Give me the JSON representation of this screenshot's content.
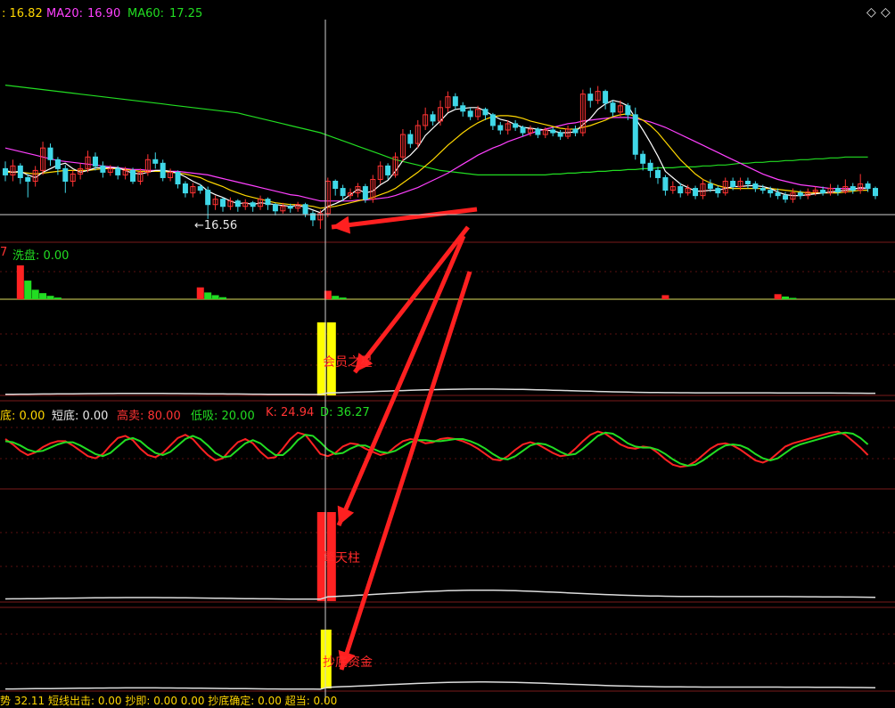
{
  "ma_legend": {
    "ma5_value": ": 16.82",
    "ma20_label": "MA20:",
    "ma20_value": "16.90",
    "ma60_label": "MA60:",
    "ma60_value": "17.25"
  },
  "panel_washout": {
    "num": "7",
    "label": "洗盘: 0.00"
  },
  "panel_kdj": {
    "bottom": "底: 0.00",
    "short_bottom": "短底: 0.00",
    "high_sell": "高卖: 80.00",
    "low_buy": "低吸: 20.00",
    "k": "K: 24.94",
    "d": "D: 36.27"
  },
  "bottom_row": "势  32.11    短线出击: 0.00   抄即: 0.00  0.00   抄底确定: 0.00   超当: 0.00",
  "annotations": {
    "low_price": "16.56",
    "star": "会员之星",
    "pillar": "擎天柱",
    "gold": "抄底资金"
  },
  "colors": {
    "up": "#ff3333",
    "down": "#40d8e8",
    "ma5": "#ffffff",
    "ma10": "#ffd700",
    "ma20": "#ff40ff",
    "ma60": "#22dd22",
    "arrow": "#ff2020"
  },
  "chart_data": {
    "type": "candlestick",
    "title": "",
    "price_range": [
      16.4,
      18.7
    ],
    "candles": [
      [
        17.12,
        17.05,
        17.2,
        16.98
      ],
      [
        17.05,
        17.15,
        17.22,
        16.98
      ],
      [
        17.15,
        17.02,
        17.18,
        16.95
      ],
      [
        17.02,
        16.98,
        17.06,
        16.8
      ],
      [
        16.98,
        17.1,
        17.15,
        16.92
      ],
      [
        17.1,
        17.35,
        17.42,
        17.05
      ],
      [
        17.35,
        17.22,
        17.4,
        17.15
      ],
      [
        17.22,
        17.12,
        17.25,
        17.05
      ],
      [
        17.12,
        16.98,
        17.16,
        16.85
      ],
      [
        16.98,
        17.06,
        17.1,
        16.92
      ],
      [
        17.06,
        17.12,
        17.18,
        17.0
      ],
      [
        17.12,
        17.25,
        17.32,
        17.08
      ],
      [
        17.25,
        17.15,
        17.3,
        17.1
      ],
      [
        17.15,
        17.08,
        17.2,
        17.02
      ],
      [
        17.08,
        17.12,
        17.16,
        17.04
      ],
      [
        17.12,
        17.05,
        17.15,
        17.0
      ],
      [
        17.05,
        17.1,
        17.14,
        17.0
      ],
      [
        17.1,
        16.98,
        17.13,
        16.95
      ],
      [
        16.98,
        17.08,
        17.12,
        16.94
      ],
      [
        17.08,
        17.22,
        17.28,
        17.04
      ],
      [
        17.22,
        17.18,
        17.3,
        17.12
      ],
      [
        17.18,
        17.02,
        17.22,
        16.98
      ],
      [
        17.02,
        17.08,
        17.12,
        16.98
      ],
      [
        17.08,
        16.95,
        17.1,
        16.9
      ],
      [
        16.95,
        16.85,
        16.98,
        16.8
      ],
      [
        16.85,
        16.92,
        16.96,
        16.8
      ],
      [
        16.92,
        16.88,
        16.95,
        16.84
      ],
      [
        16.88,
        16.72,
        16.92,
        16.56
      ],
      [
        16.72,
        16.78,
        16.82,
        16.66
      ],
      [
        16.78,
        16.7,
        16.8,
        16.64
      ],
      [
        16.7,
        16.76,
        16.8,
        16.66
      ],
      [
        16.76,
        16.7,
        16.78,
        16.64
      ],
      [
        16.7,
        16.74,
        16.78,
        16.66
      ],
      [
        16.74,
        16.7,
        16.76,
        16.64
      ],
      [
        16.7,
        16.78,
        16.82,
        16.66
      ],
      [
        16.78,
        16.72,
        16.8,
        16.66
      ],
      [
        16.72,
        16.65,
        16.74,
        16.6
      ],
      [
        16.65,
        16.7,
        16.74,
        16.62
      ],
      [
        16.7,
        16.68,
        16.73,
        16.63
      ],
      [
        16.68,
        16.72,
        16.75,
        16.64
      ],
      [
        16.72,
        16.62,
        16.74,
        16.58
      ],
      [
        16.62,
        16.55,
        16.65,
        16.48
      ],
      [
        16.55,
        16.62,
        16.66,
        16.45
      ],
      [
        16.62,
        16.98,
        17.02,
        16.58
      ],
      [
        16.98,
        16.9,
        17.0,
        16.82
      ],
      [
        16.9,
        16.82,
        16.94,
        16.76
      ],
      [
        16.82,
        16.85,
        16.9,
        16.78
      ],
      [
        16.85,
        16.92,
        16.96,
        16.8
      ],
      [
        16.92,
        16.78,
        16.95,
        16.74
      ],
      [
        16.78,
        17.0,
        17.05,
        16.74
      ],
      [
        17.0,
        17.15,
        17.2,
        16.95
      ],
      [
        17.15,
        17.05,
        17.18,
        17.0
      ],
      [
        17.05,
        17.25,
        17.3,
        17.02
      ],
      [
        17.25,
        17.5,
        17.56,
        17.2
      ],
      [
        17.5,
        17.4,
        17.55,
        17.35
      ],
      [
        17.4,
        17.6,
        17.66,
        17.35
      ],
      [
        17.6,
        17.72,
        17.8,
        17.55
      ],
      [
        17.72,
        17.65,
        17.76,
        17.6
      ],
      [
        17.65,
        17.8,
        17.88,
        17.6
      ],
      [
        17.8,
        17.92,
        17.98,
        17.75
      ],
      [
        17.92,
        17.82,
        17.96,
        17.78
      ],
      [
        17.82,
        17.76,
        17.86,
        17.7
      ],
      [
        17.76,
        17.7,
        17.8,
        17.66
      ],
      [
        17.7,
        17.78,
        17.82,
        17.66
      ],
      [
        17.78,
        17.72,
        17.8,
        17.66
      ],
      [
        17.72,
        17.6,
        17.74,
        17.55
      ],
      [
        17.6,
        17.55,
        17.64,
        17.5
      ],
      [
        17.55,
        17.62,
        17.66,
        17.5
      ],
      [
        17.62,
        17.58,
        17.66,
        17.54
      ],
      [
        17.58,
        17.52,
        17.6,
        17.48
      ],
      [
        17.52,
        17.56,
        17.6,
        17.48
      ],
      [
        17.56,
        17.5,
        17.58,
        17.46
      ],
      [
        17.5,
        17.55,
        17.58,
        17.46
      ],
      [
        17.55,
        17.52,
        17.58,
        17.48
      ],
      [
        17.52,
        17.48,
        17.55,
        17.44
      ],
      [
        17.48,
        17.56,
        17.6,
        17.45
      ],
      [
        17.56,
        17.52,
        17.6,
        17.48
      ],
      [
        17.52,
        17.95,
        18.0,
        17.48
      ],
      [
        17.95,
        17.88,
        18.02,
        17.8
      ],
      [
        17.88,
        17.98,
        18.04,
        17.84
      ],
      [
        17.98,
        17.85,
        18.0,
        17.78
      ],
      [
        17.85,
        17.75,
        17.88,
        17.7
      ],
      [
        17.75,
        17.82,
        17.88,
        17.7
      ],
      [
        17.82,
        17.72,
        17.85,
        17.66
      ],
      [
        17.72,
        17.28,
        17.8,
        17.22
      ],
      [
        17.28,
        17.18,
        17.32,
        17.1
      ],
      [
        17.18,
        17.1,
        17.22,
        17.02
      ],
      [
        17.1,
        17.02,
        17.14,
        16.95
      ],
      [
        17.02,
        16.88,
        17.05,
        16.82
      ],
      [
        16.88,
        16.92,
        16.98,
        16.84
      ],
      [
        16.92,
        16.85,
        16.96,
        16.8
      ],
      [
        16.85,
        16.9,
        16.94,
        16.82
      ],
      [
        16.9,
        16.82,
        16.93,
        16.78
      ],
      [
        16.82,
        16.95,
        17.0,
        16.78
      ],
      [
        16.95,
        16.9,
        17.0,
        16.86
      ],
      [
        16.9,
        16.85,
        16.93,
        16.8
      ],
      [
        16.85,
        16.98,
        17.02,
        16.82
      ],
      [
        16.98,
        16.92,
        17.02,
        16.88
      ],
      [
        16.92,
        16.98,
        17.02,
        16.88
      ],
      [
        16.98,
        16.95,
        17.02,
        16.9
      ],
      [
        16.95,
        16.9,
        16.98,
        16.86
      ],
      [
        16.9,
        16.88,
        16.94,
        16.84
      ],
      [
        16.88,
        16.85,
        16.92,
        16.8
      ],
      [
        16.85,
        16.82,
        16.9,
        16.78
      ],
      [
        16.82,
        16.78,
        16.86,
        16.74
      ],
      [
        16.78,
        16.85,
        16.9,
        16.74
      ],
      [
        16.85,
        16.82,
        16.88,
        16.78
      ],
      [
        16.82,
        16.86,
        16.9,
        16.78
      ],
      [
        16.86,
        16.88,
        16.92,
        16.82
      ],
      [
        16.88,
        16.85,
        16.92,
        16.82
      ],
      [
        16.85,
        16.9,
        16.95,
        16.82
      ],
      [
        16.9,
        16.86,
        16.94,
        16.82
      ],
      [
        16.86,
        16.92,
        17.0,
        16.84
      ],
      [
        16.92,
        16.88,
        16.96,
        16.84
      ],
      [
        16.88,
        16.95,
        17.06,
        16.84
      ],
      [
        16.95,
        16.9,
        16.98,
        16.86
      ],
      [
        16.9,
        16.82,
        16.92,
        16.78
      ]
    ],
    "ma5": [
      17.1,
      17.08,
      17.09,
      17.05,
      17.02,
      17.08,
      17.12,
      17.16,
      17.18,
      17.12,
      17.08,
      17.1,
      17.13,
      17.13,
      17.13,
      17.13,
      17.1,
      17.07,
      17.06,
      17.08,
      17.1,
      17.1,
      17.09,
      17.07,
      17.03,
      16.98,
      16.94,
      16.87,
      16.83,
      16.8,
      16.76,
      16.73,
      16.74,
      16.72,
      16.74,
      16.73,
      16.72,
      16.71,
      16.7,
      16.71,
      16.69,
      16.66,
      16.63,
      16.7,
      16.73,
      16.77,
      16.83,
      16.89,
      16.85,
      16.87,
      16.94,
      16.99,
      17.09,
      17.21,
      17.27,
      17.36,
      17.49,
      17.57,
      17.65,
      17.74,
      17.78,
      17.79,
      17.8,
      17.8,
      17.76,
      17.71,
      17.67,
      17.65,
      17.61,
      17.58,
      17.57,
      17.56,
      17.55,
      17.54,
      17.52,
      17.52,
      17.53,
      17.61,
      17.68,
      17.78,
      17.84,
      17.88,
      17.86,
      17.82,
      17.68,
      17.55,
      17.41,
      17.26,
      17.09,
      17.02,
      16.95,
      16.91,
      16.87,
      16.87,
      16.88,
      16.88,
      16.9,
      16.92,
      16.92,
      16.93,
      16.93,
      16.92,
      16.9,
      16.86,
      16.83,
      16.82,
      16.82,
      16.83,
      16.84,
      16.85,
      16.86,
      16.87,
      16.88,
      16.89,
      16.91,
      16.9
    ],
    "ma10": [
      17.08,
      17.08,
      17.08,
      17.07,
      17.06,
      17.07,
      17.08,
      17.09,
      17.1,
      17.1,
      17.1,
      17.1,
      17.11,
      17.12,
      17.12,
      17.12,
      17.11,
      17.1,
      17.09,
      17.09,
      17.09,
      17.09,
      17.08,
      17.07,
      17.06,
      17.04,
      17.02,
      16.98,
      16.95,
      16.92,
      16.88,
      16.85,
      16.82,
      16.8,
      16.78,
      16.76,
      16.74,
      16.73,
      16.72,
      16.72,
      16.71,
      16.7,
      16.68,
      16.69,
      16.7,
      16.72,
      16.74,
      16.76,
      16.78,
      16.8,
      16.83,
      16.86,
      16.9,
      16.96,
      17.02,
      17.08,
      17.15,
      17.22,
      17.3,
      17.38,
      17.45,
      17.52,
      17.58,
      17.63,
      17.67,
      17.7,
      17.71,
      17.71,
      17.7,
      17.68,
      17.65,
      17.63,
      17.61,
      17.59,
      17.57,
      17.56,
      17.56,
      17.58,
      17.6,
      17.63,
      17.66,
      17.7,
      17.72,
      17.73,
      17.7,
      17.66,
      17.6,
      17.52,
      17.42,
      17.32,
      17.22,
      17.14,
      17.06,
      17.0,
      16.96,
      16.93,
      16.91,
      16.9,
      16.9,
      16.9,
      16.9,
      16.9,
      16.9,
      16.89,
      16.88,
      16.87,
      16.86,
      16.85,
      16.85,
      16.85,
      16.85,
      16.85,
      16.86,
      16.87,
      16.88,
      16.88
    ],
    "ma20": [
      17.35,
      17.33,
      17.31,
      17.29,
      17.27,
      17.25,
      17.23,
      17.21,
      17.2,
      17.19,
      17.18,
      17.17,
      17.16,
      17.15,
      17.14,
      17.13,
      17.12,
      17.11,
      17.11,
      17.1,
      17.1,
      17.1,
      17.09,
      17.09,
      17.08,
      17.07,
      17.06,
      17.05,
      17.03,
      17.01,
      16.99,
      16.97,
      16.95,
      16.93,
      16.91,
      16.89,
      16.87,
      16.85,
      16.83,
      16.82,
      16.8,
      16.78,
      16.76,
      16.76,
      16.76,
      16.76,
      16.76,
      16.77,
      16.77,
      16.78,
      16.79,
      16.8,
      16.82,
      16.85,
      16.88,
      16.91,
      16.95,
      16.99,
      17.03,
      17.07,
      17.12,
      17.17,
      17.22,
      17.27,
      17.31,
      17.35,
      17.38,
      17.42,
      17.45,
      17.48,
      17.51,
      17.54,
      17.56,
      17.58,
      17.6,
      17.62,
      17.63,
      17.65,
      17.66,
      17.67,
      17.68,
      17.69,
      17.69,
      17.69,
      17.68,
      17.66,
      17.64,
      17.61,
      17.58,
      17.54,
      17.5,
      17.46,
      17.42,
      17.38,
      17.34,
      17.3,
      17.26,
      17.22,
      17.18,
      17.14,
      17.1,
      17.06,
      17.03,
      17.0,
      16.98,
      16.96,
      16.94,
      16.93,
      16.92,
      16.91,
      16.9,
      16.9,
      16.9,
      16.9,
      16.9,
      16.9
    ],
    "ma60": [
      18.05,
      18.04,
      18.03,
      18.02,
      18.01,
      18.0,
      17.99,
      17.98,
      17.97,
      17.96,
      17.95,
      17.94,
      17.93,
      17.92,
      17.91,
      17.9,
      17.89,
      17.88,
      17.87,
      17.86,
      17.85,
      17.84,
      17.83,
      17.82,
      17.81,
      17.8,
      17.79,
      17.78,
      17.77,
      17.76,
      17.75,
      17.74,
      17.72,
      17.7,
      17.68,
      17.66,
      17.64,
      17.62,
      17.6,
      17.58,
      17.56,
      17.54,
      17.52,
      17.49,
      17.46,
      17.43,
      17.4,
      17.37,
      17.34,
      17.31,
      17.28,
      17.25,
      17.22,
      17.2,
      17.18,
      17.16,
      17.14,
      17.12,
      17.1,
      17.09,
      17.08,
      17.07,
      17.06,
      17.05,
      17.05,
      17.05,
      17.05,
      17.05,
      17.05,
      17.05,
      17.05,
      17.05,
      17.05,
      17.06,
      17.06,
      17.07,
      17.07,
      17.08,
      17.08,
      17.09,
      17.09,
      17.1,
      17.1,
      17.11,
      17.11,
      17.12,
      17.12,
      17.13,
      17.13,
      17.13,
      17.14,
      17.14,
      17.14,
      17.15,
      17.15,
      17.16,
      17.16,
      17.17,
      17.18,
      17.18,
      17.19,
      17.19,
      17.2,
      17.2,
      17.21,
      17.21,
      17.22,
      17.22,
      17.23,
      17.23,
      17.24,
      17.24,
      17.25,
      17.25,
      17.25,
      17.25
    ],
    "washout": [
      {
        "i": 2,
        "h": 1.0,
        "c": "r"
      },
      {
        "i": 3,
        "h": 0.55,
        "c": "g"
      },
      {
        "i": 4,
        "h": 0.28,
        "c": "g"
      },
      {
        "i": 5,
        "h": 0.18,
        "c": "g"
      },
      {
        "i": 6,
        "h": 0.1,
        "c": "g"
      },
      {
        "i": 7,
        "h": 0.05,
        "c": "g"
      },
      {
        "i": 26,
        "h": 0.35,
        "c": "r"
      },
      {
        "i": 27,
        "h": 0.2,
        "c": "g"
      },
      {
        "i": 28,
        "h": 0.12,
        "c": "g"
      },
      {
        "i": 29,
        "h": 0.06,
        "c": "g"
      },
      {
        "i": 43,
        "h": 0.25,
        "c": "r"
      },
      {
        "i": 44,
        "h": 0.1,
        "c": "g"
      },
      {
        "i": 45,
        "h": 0.05,
        "c": "g"
      },
      {
        "i": 88,
        "h": 0.12,
        "c": "r"
      },
      {
        "i": 103,
        "h": 0.15,
        "c": "r"
      },
      {
        "i": 104,
        "h": 0.08,
        "c": "g"
      },
      {
        "i": 105,
        "h": 0.04,
        "c": "g"
      }
    ],
    "stoch_k": [
      70,
      60,
      48,
      40,
      45,
      55,
      62,
      66,
      66,
      58,
      48,
      38,
      34,
      42,
      58,
      72,
      76,
      68,
      52,
      40,
      36,
      44,
      58,
      72,
      78,
      70,
      54,
      40,
      30,
      34,
      50,
      64,
      70,
      62,
      46,
      34,
      36,
      52,
      70,
      82,
      78,
      60,
      42,
      38,
      44,
      56,
      62,
      60,
      52,
      46,
      40,
      44,
      56,
      66,
      70,
      68,
      62,
      64,
      70,
      72,
      70,
      66,
      60,
      52,
      42,
      32,
      30,
      38,
      50,
      60,
      64,
      60,
      52,
      44,
      38,
      40,
      52,
      66,
      78,
      84,
      80,
      70,
      60,
      54,
      52,
      56,
      54,
      44,
      32,
      22,
      18,
      20,
      28,
      40,
      52,
      60,
      62,
      58,
      50,
      40,
      30,
      26,
      32,
      44,
      56,
      62,
      66,
      70,
      74,
      78,
      82,
      84,
      78,
      66,
      54,
      40
    ],
    "stoch_d": [
      66,
      64,
      58,
      50,
      46,
      48,
      54,
      60,
      64,
      64,
      58,
      50,
      42,
      38,
      44,
      56,
      68,
      72,
      66,
      54,
      44,
      40,
      46,
      58,
      70,
      76,
      70,
      58,
      44,
      36,
      38,
      50,
      62,
      68,
      62,
      50,
      40,
      40,
      52,
      68,
      78,
      76,
      64,
      50,
      42,
      44,
      52,
      58,
      58,
      52,
      46,
      44,
      48,
      56,
      64,
      68,
      68,
      66,
      66,
      68,
      70,
      70,
      66,
      60,
      52,
      42,
      34,
      32,
      38,
      48,
      58,
      62,
      60,
      54,
      46,
      40,
      42,
      52,
      64,
      76,
      82,
      80,
      72,
      62,
      56,
      54,
      54,
      50,
      42,
      32,
      24,
      20,
      22,
      30,
      40,
      50,
      58,
      60,
      58,
      52,
      42,
      34,
      30,
      34,
      44,
      54,
      60,
      64,
      68,
      72,
      76,
      80,
      82,
      80,
      72,
      60
    ]
  }
}
